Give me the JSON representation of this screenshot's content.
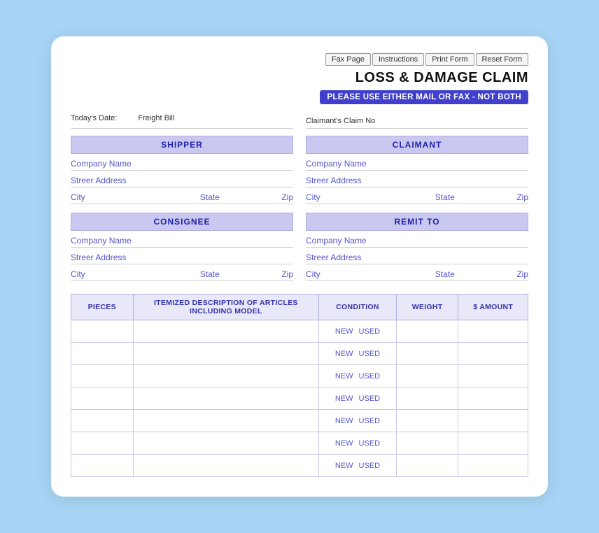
{
  "topButtons": [
    {
      "id": "fax-page-btn",
      "label": "Fax Page"
    },
    {
      "id": "instructions-btn",
      "label": "Instructions"
    },
    {
      "id": "print-form-btn",
      "label": "Print Form"
    },
    {
      "id": "reset-form-btn",
      "label": "Reset Form"
    }
  ],
  "title": "LOSS & DAMAGE CLAIM",
  "notice": "PLEASE USE EITHER MAIL OR FAX - NOT BOTH",
  "fields": {
    "todaysDate": "Today's Date:",
    "freightBill": "Freight Bill",
    "claimantsClaimNo": "Claimant's Claim No"
  },
  "sections": {
    "shipper": {
      "header": "SHIPPER",
      "companyName": "Company Name",
      "streetAddress": "Streer Address",
      "city": "City",
      "state": "State",
      "zip": "Zip"
    },
    "claimant": {
      "header": "CLAIMANT",
      "companyName": "Company Name",
      "streetAddress": "Streer Address",
      "city": "City",
      "state": "State",
      "zip": "Zip"
    },
    "consignee": {
      "header": "CONSIGNEE",
      "companyName": "Company Name",
      "streetAddress": "Streer Address",
      "city": "City",
      "state": "State",
      "zip": "Zip"
    },
    "remitTo": {
      "header": "REMIT TO",
      "companyName": "Company Name",
      "streetAddress": "Streer Address",
      "city": "City",
      "state": "State",
      "zip": "Zip"
    }
  },
  "table": {
    "headers": {
      "pieces": "PIECES",
      "description": "ITEMIZED DESCRIPTION OF ARTICLES INCLUDING MODEL",
      "condition": "CONDITION",
      "weight": "WEIGHT",
      "amount": "$ AMOUNT"
    },
    "conditionOptions": [
      "NEW",
      "USED"
    ],
    "rows": 7
  }
}
